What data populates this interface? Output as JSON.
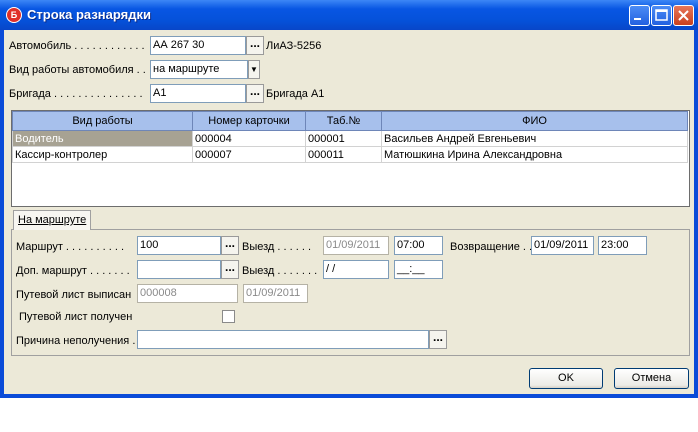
{
  "window": {
    "title": "Строка разнарядки"
  },
  "vehicle": {
    "label": "Автомобиль . . . . . . . . . . . .",
    "value": "АА 267 30",
    "desc": "ЛиАЗ-5256"
  },
  "work_type": {
    "label": "Вид работы автомобиля . .",
    "value": "на маршруте"
  },
  "brigade": {
    "label": "Бригада . . . . . . . . . . . . . . .",
    "value": "А1",
    "desc": "Бригада А1"
  },
  "table": {
    "columns": [
      "Вид работы",
      "Номер карточки",
      "Таб.№",
      "ФИО"
    ],
    "rows": [
      [
        "Водитель",
        "000004",
        "000001",
        "Васильев Андрей Евгеньевич"
      ],
      [
        "Кассир-контролер",
        "000007",
        "000011",
        "Матюшкина Ирина Александровна"
      ]
    ]
  },
  "tab": {
    "label": "На маршруте"
  },
  "route": {
    "label": "Маршрут . . . . . . . . . .",
    "value": "100"
  },
  "depart1": {
    "label": "Выезд . . . . . .",
    "date": "01/09/2011",
    "time": "07:00"
  },
  "return": {
    "label": "Возвращение . .",
    "date": "01/09/2011",
    "time": "23:00"
  },
  "extra_route": {
    "label": "Доп. маршрут . . . . . . .",
    "value": ""
  },
  "depart2": {
    "label": "Выезд . . . . . . .",
    "date": " / /",
    "time": "__:__"
  },
  "waybill_issued": {
    "label": "Путевой лист выписан",
    "number": "000008",
    "date": "01/09/2011"
  },
  "waybill_received": {
    "label": "Путевой лист получен"
  },
  "reason": {
    "label": "Причина неполучения .",
    "value": ""
  },
  "buttons": {
    "ok": "OK",
    "cancel": "Отмена",
    "dots": "..."
  },
  "colors": {
    "title_bar": "#0551d9",
    "grid_header": "#a7c0ec",
    "selected_cell": "#a7a293"
  }
}
